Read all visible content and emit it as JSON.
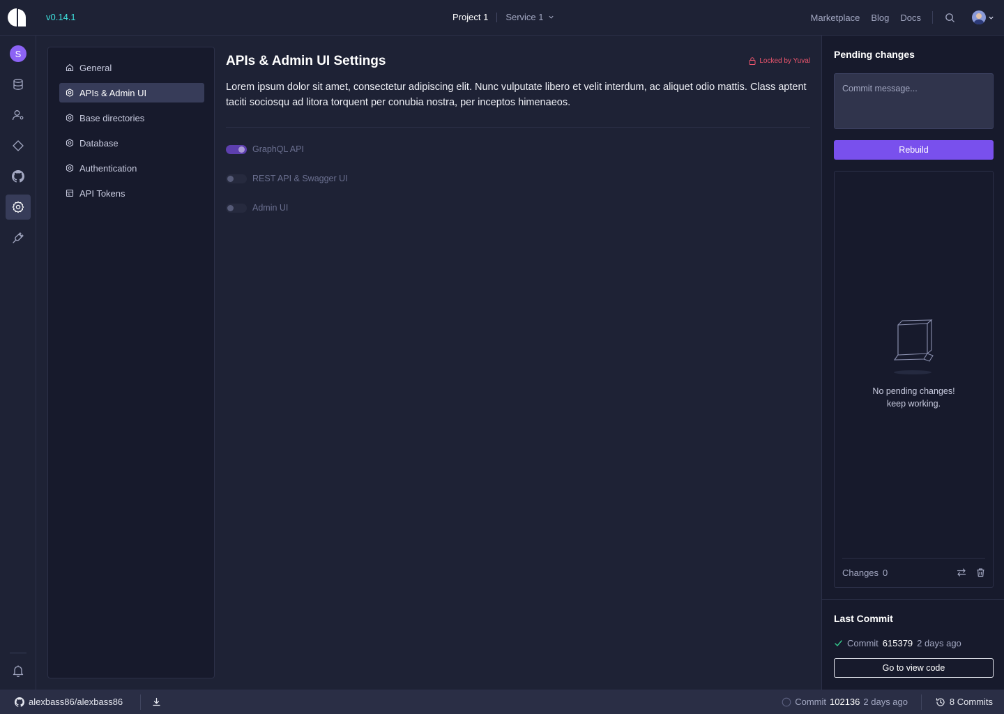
{
  "app": {
    "version": "v0.14.1"
  },
  "header": {
    "project": "Project 1",
    "service": "Service 1",
    "links": [
      "Marketplace",
      "Blog",
      "Docs"
    ]
  },
  "rail": {
    "workspace_initial": "S",
    "icons": [
      "workspace-avatar",
      "database-icon",
      "user-icon",
      "diamond-icon",
      "github-icon",
      "settings-icon",
      "plugin-icon",
      "bell-icon"
    ]
  },
  "settings_nav": {
    "items": [
      {
        "label": "General",
        "icon": "home-icon"
      },
      {
        "label": "APIs & Admin UI",
        "icon": "gear-icon",
        "active": true
      },
      {
        "label": "Base directories",
        "icon": "gear-icon"
      },
      {
        "label": "Database",
        "icon": "gear-icon"
      },
      {
        "label": "Authentication",
        "icon": "gear-icon"
      },
      {
        "label": "API Tokens",
        "icon": "token-icon"
      }
    ]
  },
  "main": {
    "title": "APIs & Admin UI Settings",
    "locked_label": "Locked by Yuval",
    "description": "Lorem ipsum dolor sit amet, consectetur adipiscing elit. Nunc vulputate libero et velit interdum, ac aliquet odio mattis. Class aptent taciti sociosqu ad litora torquent per conubia nostra, per inceptos himenaeos.",
    "toggles": [
      {
        "label": "GraphQL API",
        "on": true
      },
      {
        "label": "REST API & Swagger UI",
        "on": false
      },
      {
        "label": "Admin UI",
        "on": false
      }
    ]
  },
  "pending": {
    "title": "Pending changes",
    "commit_placeholder": "Commit message...",
    "rebuild_label": "Rebuild",
    "empty_line1": "No pending changes!",
    "empty_line2": "keep working.",
    "changes_label": "Changes",
    "changes_count": "0"
  },
  "last_commit": {
    "title": "Last Commit",
    "prefix": "Commit",
    "hash": "615379",
    "time": "2 days ago",
    "view_code_label": "Go to view code"
  },
  "statusbar": {
    "repo": "alexbass86/alexbass86",
    "commit_prefix": "Commit",
    "commit_hash": "102136",
    "commit_time": "2 days ago",
    "commits_label": "8 Commits"
  },
  "colors": {
    "accent": "#7950ed",
    "version": "#3ee4e0",
    "locked": "#f0566e",
    "background": "#1e2235",
    "panel": "#171a2c"
  }
}
